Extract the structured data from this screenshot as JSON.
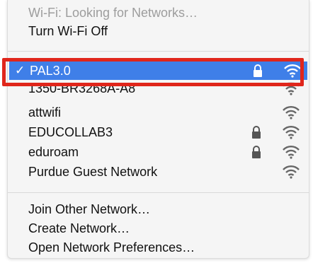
{
  "status": {
    "label": "Wi-Fi: Looking for Networks…",
    "toggle_label": "Turn Wi-Fi Off"
  },
  "networks": [
    {
      "name": "PAL3.0",
      "connected": true,
      "locked": true
    },
    {
      "name": "1350-BR3268A-A8",
      "connected": false,
      "locked": false
    },
    {
      "name": "attwifi",
      "connected": false,
      "locked": false
    },
    {
      "name": "EDUCOLLAB3",
      "connected": false,
      "locked": true
    },
    {
      "name": "eduroam",
      "connected": false,
      "locked": true
    },
    {
      "name": "Purdue Guest Network",
      "connected": false,
      "locked": false
    }
  ],
  "checkmark": "✓",
  "actions": {
    "join_other": "Join Other Network…",
    "create": "Create Network…",
    "open_prefs": "Open Network Preferences…"
  },
  "colors": {
    "selection": "#3f7fe8",
    "annotation_box": "#e0261b"
  }
}
